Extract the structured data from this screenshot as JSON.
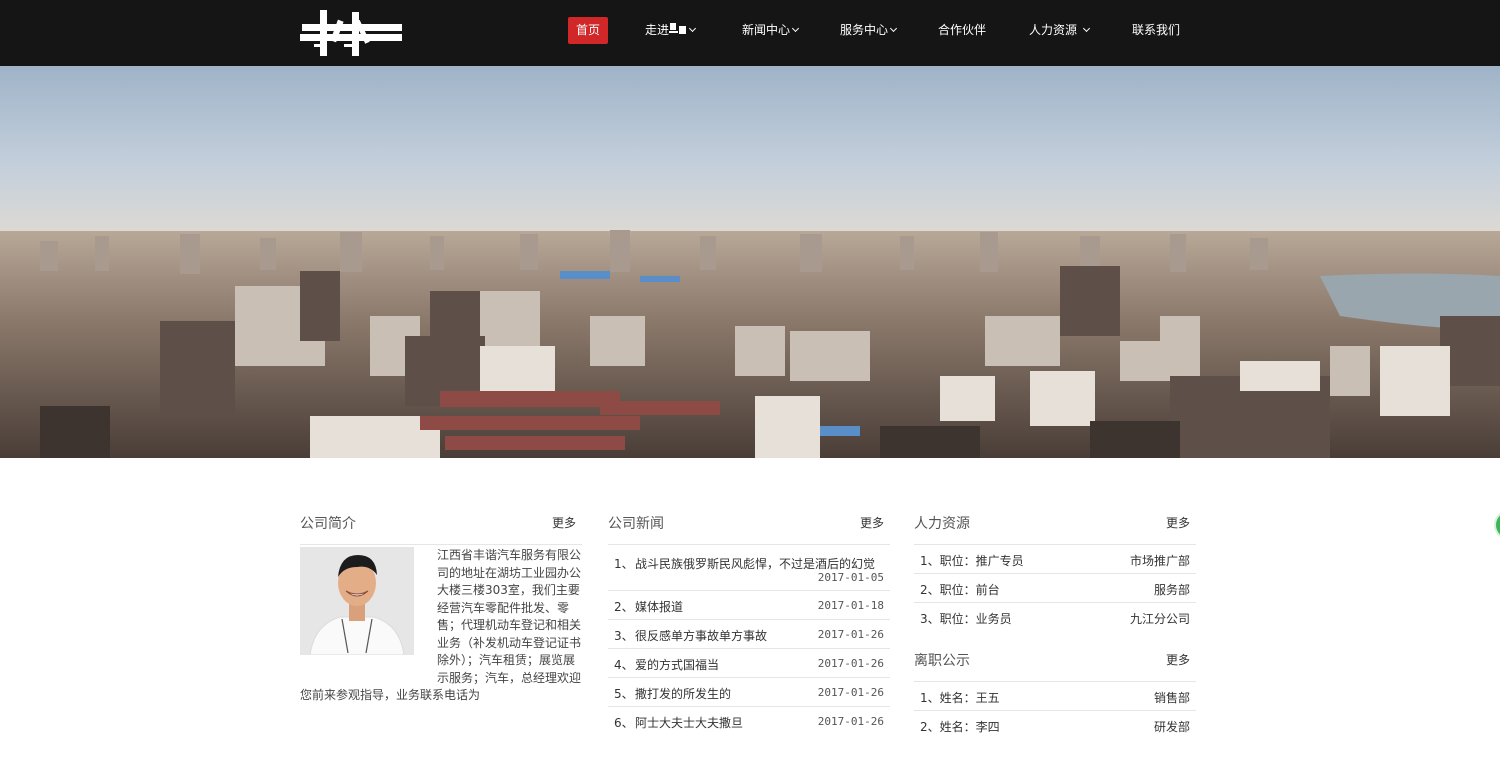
{
  "nav": {
    "items": [
      {
        "label": "首页",
        "active": true
      },
      {
        "label": "走进",
        "dropdown": true
      },
      {
        "label": "新闻中心",
        "dropdown": true
      },
      {
        "label": "服务中心",
        "dropdown": true
      },
      {
        "label": "合作伙伴",
        "dropdown": false
      },
      {
        "label": "人力资源",
        "dropdown": true
      },
      {
        "label": "联系我们",
        "dropdown": false
      }
    ]
  },
  "about": {
    "title": "公司简介",
    "more": "更多",
    "text": "江西省丰谐汽车服务有限公司的地址在湖坊工业园办公大楼三楼303室，我们主要经营汽车零配件批发、零售；代理机动车登记和相关业务（补发机动车登记证书除外）；汽车租赁；展览展示服务；汽车，总经理欢迎您前来参观指导，业务联系电话为"
  },
  "news": {
    "title": "公司新闻",
    "more": "更多",
    "items": [
      {
        "num": "1、",
        "title": "战斗民族俄罗斯民风彪悍，不过是酒后的幻觉",
        "date": "2017-01-05"
      },
      {
        "num": "2、",
        "title": "媒体报道",
        "date": "2017-01-18"
      },
      {
        "num": "3、",
        "title": "很反感单方事故单方事故",
        "date": "2017-01-26"
      },
      {
        "num": "4、",
        "title": "爱的方式国福当",
        "date": "2017-01-26"
      },
      {
        "num": "5、",
        "title": "撒打发的所发生的",
        "date": "2017-01-26"
      },
      {
        "num": "6、",
        "title": "阿士大夫士大夫撒旦",
        "date": "2017-01-26"
      }
    ]
  },
  "hr": {
    "title": "人力资源",
    "more": "更多",
    "items": [
      {
        "left": "1、职位：推广专员",
        "right": "市场推广部"
      },
      {
        "left": "2、职位：前台",
        "right": "服务部"
      },
      {
        "left": "3、职位：业务员",
        "right": "九江分公司"
      }
    ]
  },
  "resign": {
    "title": "离职公示",
    "more": "更多",
    "items": [
      {
        "left": "1、姓名：王五",
        "right": "销售部"
      },
      {
        "left": "2、姓名：李四",
        "right": "研发部"
      }
    ]
  },
  "colors": {
    "header_bg": "#151515",
    "accent": "#d02828"
  }
}
